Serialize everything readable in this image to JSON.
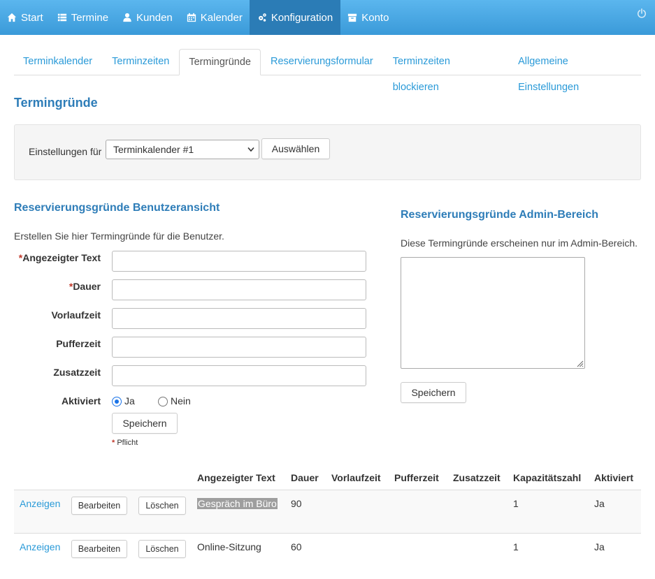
{
  "nav": {
    "items": [
      {
        "label": "Start",
        "icon": "home-icon"
      },
      {
        "label": "Termine",
        "icon": "list-icon"
      },
      {
        "label": "Kunden",
        "icon": "user-icon"
      },
      {
        "label": "Kalender",
        "icon": "calendar-icon"
      },
      {
        "label": "Konfiguration",
        "icon": "gears-icon",
        "active": true
      },
      {
        "label": "Konto",
        "icon": "archive-icon"
      }
    ],
    "accent": "#3a9ad9",
    "active_bg": "#2b7cb6"
  },
  "tabs": [
    "Terminkalender",
    "Terminzeiten",
    "Termingründe",
    "Reservierungsformular",
    "Terminzeiten blockieren",
    "Allgemeine Einstellungen"
  ],
  "active_tab": "Termingründe",
  "page_title": "Termingründe",
  "settings": {
    "label": "Einstellungen für",
    "selected": "Terminkalender #1",
    "select_button": "Auswählen"
  },
  "user_section": {
    "title": "Reservierungsgründe Benutzeransicht",
    "description": "Erstellen Sie hier Termingründe für die Benutzer.",
    "fields": {
      "text": "Angezeigter Text",
      "dauer": "Dauer",
      "vorlaufzeit": "Vorlaufzeit",
      "pufferzeit": "Pufferzeit",
      "zusatzzeit": "Zusatzzeit",
      "aktiviert": "Aktiviert"
    },
    "radio_yes": "Ja",
    "radio_no": "Nein",
    "save": "Speichern",
    "required_note": "Pflicht",
    "required_mark": "*"
  },
  "admin_section": {
    "title": "Reservierungsgründe Admin-Bereich",
    "description": "Diese Termingründe erscheinen nur im Admin-Bereich.",
    "save": "Speichern"
  },
  "table": {
    "headers": [
      "Angezeigter Text",
      "Dauer",
      "Vorlaufzeit",
      "Pufferzeit",
      "Zusatzzeit",
      "Kapazitätszahl",
      "Aktiviert"
    ],
    "view_label": "Anzeigen",
    "edit_label": "Bearbeiten",
    "delete_label": "Löschen",
    "rows": [
      {
        "text": "Gespräch im Büro",
        "dauer": "90",
        "vorlaufzeit": "",
        "pufferzeit": "",
        "zusatzzeit": "",
        "kapazitaet": "1",
        "aktiviert": "Ja"
      },
      {
        "text": "Online-Sitzung",
        "dauer": "60",
        "vorlaufzeit": "",
        "pufferzeit": "",
        "zusatzzeit": "",
        "kapazitaet": "1",
        "aktiviert": "Ja"
      }
    ]
  }
}
